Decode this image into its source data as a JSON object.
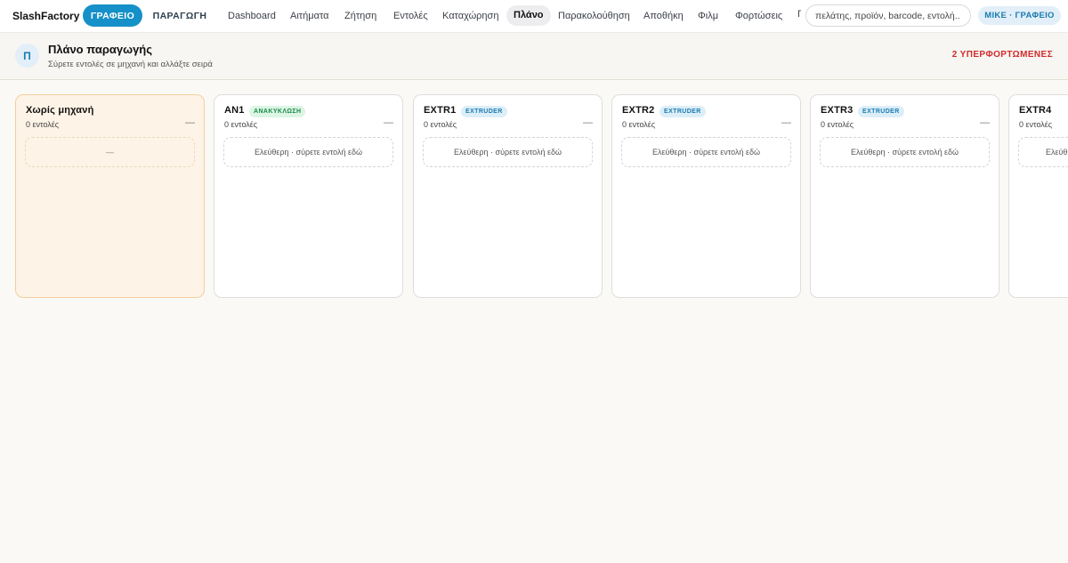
{
  "app": {
    "brand": "SlashFactory",
    "modes": [
      "ΓΡΑΦΕΙΟ",
      "ΠΑΡΑΓΩΓΗ"
    ],
    "nav": [
      {
        "label": "Dashboard",
        "active": false
      },
      {
        "label": "Αιτήματα",
        "active": false
      },
      {
        "label": "Ζήτηση",
        "active": false
      },
      {
        "label": "Εντολές",
        "active": false
      },
      {
        "label": "Καταχώρηση",
        "active": false
      },
      {
        "label": "Πλάνο",
        "active": true
      },
      {
        "label": "Παρακολούθηση",
        "active": false
      },
      {
        "label": "Αποθήκη",
        "active": false
      },
      {
        "label": "Φιλμ",
        "active": false
      },
      {
        "label": "Φορτώσεις",
        "active": false
      },
      {
        "label": "Γ",
        "active": false
      }
    ],
    "search_placeholder": "πελάτης, προϊόν, barcode, εντολή..",
    "user_badge": "MIKE · ΓΡΑΦΕΙΟ"
  },
  "header": {
    "avatar_letter": "Π",
    "title": "Πλάνο παραγωγής",
    "subtitle": "Σύρετε εντολές σε μηχανή και αλλάξτε σειρά",
    "overload": "2 ΥΠΕΡΦΟΡΤΩΜΕΝΕΣ"
  },
  "columns": [
    {
      "name": "Χωρίς μηχανή",
      "tag": "",
      "count": "0 εντολές",
      "toggle": "—",
      "drop": "—"
    },
    {
      "name": "AN1",
      "tag": "ΑΝΑΚΥΚΛΩΣΗ",
      "tag_color": "#1b8a4a",
      "count": "0 εντολές",
      "toggle": "—",
      "drop": "Ελεύθερη · σύρετε εντολή εδώ"
    },
    {
      "name": "EXTR1",
      "tag": "EXTRUDER",
      "tag_color": "#1b7bb0",
      "count": "0 εντολές",
      "toggle": "—",
      "drop": "Ελεύθερη · σύρετε εντολή εδώ"
    },
    {
      "name": "EXTR2",
      "tag": "EXTRUDER",
      "tag_color": "#1b7bb0",
      "count": "0 εντολές",
      "toggle": "—",
      "drop": "Ελεύθερη · σύρετε εντολή εδώ"
    },
    {
      "name": "EXTR3",
      "tag": "EXTRUDER",
      "tag_color": "#1b7bb0",
      "count": "0 εντολές",
      "toggle": "—",
      "drop": "Ελεύθερη · σύρετε εντολή εδώ"
    },
    {
      "name": "EXTR4",
      "tag": "",
      "count": "0 εντολές",
      "toggle": "",
      "drop": "Ελεύθ"
    }
  ]
}
